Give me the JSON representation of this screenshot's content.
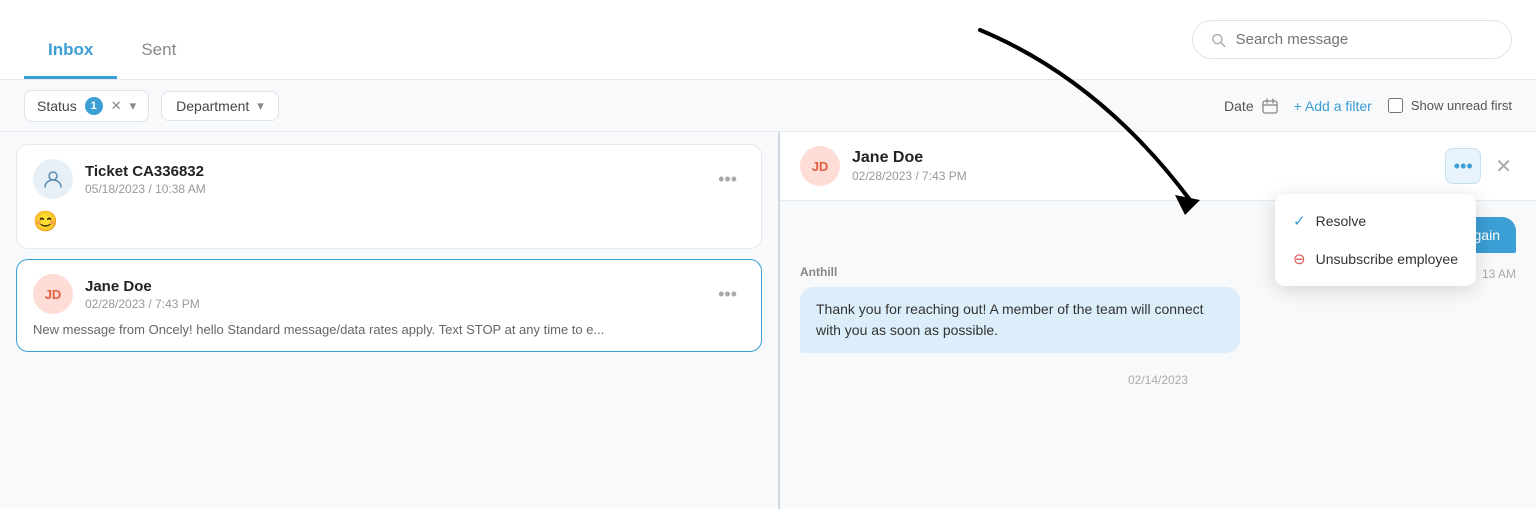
{
  "tabs": {
    "inbox": {
      "label": "Inbox",
      "active": true
    },
    "sent": {
      "label": "Sent",
      "active": false
    }
  },
  "search": {
    "placeholder": "Search message"
  },
  "filters": {
    "status_label": "Status",
    "status_count": "1",
    "department_label": "Department",
    "date_label": "Date",
    "add_filter_label": "+ Add a filter",
    "show_unread_label": "Show unread first"
  },
  "messages": [
    {
      "id": "ticket-ca336832",
      "title": "Ticket CA336832",
      "date": "05/18/2023 / 10:38 AM",
      "emoji": "😊",
      "preview": "",
      "avatar_type": "person",
      "selected": false
    },
    {
      "id": "jane-doe",
      "title": "Jane Doe",
      "date": "02/28/2023 / 7:43 PM",
      "preview": "New message from Oncely! hello Standard message/data rates apply. Text STOP at any time to e...",
      "avatar_initials": "JD",
      "selected": true
    }
  ],
  "detail": {
    "name": "Jane Doe",
    "date": "02/28/2023 / 7:43 PM",
    "avatar_initials": "JD",
    "messages": [
      {
        "type": "user",
        "text": "Hello again"
      },
      {
        "type": "anthill",
        "sender": "Anthill",
        "text": "Thank you for reaching out! A member of the team will connect with you as soon as possible.",
        "time": "13 AM"
      }
    ],
    "date_divider": "02/14/2023"
  },
  "context_menu": {
    "resolve_label": "Resolve",
    "unsubscribe_label": "Unsubscribe employee"
  }
}
